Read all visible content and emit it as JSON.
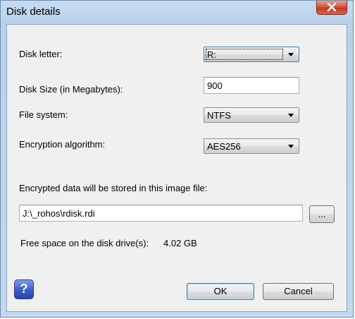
{
  "window": {
    "title": "Disk details"
  },
  "form": {
    "disk_letter": {
      "label": "Disk letter:",
      "value": "R:"
    },
    "disk_size": {
      "label": "Disk Size (in Megabytes):",
      "value": "900"
    },
    "file_system": {
      "label": "File system:",
      "value": "NTFS"
    },
    "encryption": {
      "label": "Encryption algorithm:",
      "value": "AES256"
    },
    "image_file": {
      "label": "Encrypted data will be stored in this image file:",
      "value": "J:\\_rohos\\rdisk.rdi",
      "browse_label": "..."
    },
    "free_space": {
      "label": "Free space on the disk drive(s):",
      "value": "4.02 GB"
    }
  },
  "footer": {
    "help_label": "?",
    "ok_label": "OK",
    "cancel_label": "Cancel"
  },
  "icons": {
    "close": "close-icon",
    "help": "help-icon",
    "dropdown": "chevron-down-icon"
  },
  "colors": {
    "titlebar": "#b8d1ec",
    "close_button": "#c23a1e",
    "client_bg": "#f0f0f0",
    "help_button": "#3a5cc8"
  }
}
